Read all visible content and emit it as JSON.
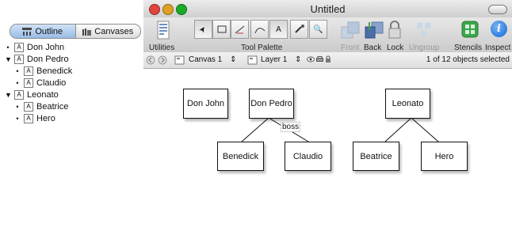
{
  "outline": {
    "tabs": [
      {
        "label": "Outline",
        "icon": "hierarchy-icon",
        "active": true
      },
      {
        "label": "Canvases",
        "icon": "canvases-icon",
        "active": false
      }
    ],
    "tree": [
      {
        "label": "Don John",
        "marker": "•",
        "icon_letter": "A"
      },
      {
        "label": "Don Pedro",
        "marker": "▼",
        "icon_letter": "A"
      },
      {
        "label": "Benedick",
        "marker": "•",
        "icon_letter": "A"
      },
      {
        "label": "Claudio",
        "marker": "•",
        "icon_letter": "A"
      },
      {
        "label": "Leonato",
        "marker": "▼",
        "icon_letter": "A"
      },
      {
        "label": "Beatrice",
        "marker": "•",
        "icon_letter": "A"
      },
      {
        "label": "Hero",
        "marker": "•",
        "icon_letter": "A"
      }
    ]
  },
  "window": {
    "title": "Untitled",
    "traffic_colors": {
      "close": "#e0443e",
      "minimize": "#dea123",
      "zoom": "#1aab29"
    }
  },
  "toolbar": {
    "utilities_label": "Utilities",
    "tool_palette_label": "Tool Palette",
    "front_label": "Front",
    "back_label": "Back",
    "lock_label": "Lock",
    "ungroup_label": "Ungroup",
    "stencils_label": "Stencils",
    "inspect_label": "Inspect",
    "tool_glyphs": {
      "select": "➤",
      "text": "A",
      "zoom": "🔍",
      "inspect": "i"
    },
    "accent": "#2f7de1",
    "stencil_color": "#3aa64a"
  },
  "subbar": {
    "canvas_label": "Canvas 1",
    "layer_label": "Layer 1",
    "stepper": "⇕",
    "selection_status": "1 of 12 objects selected"
  },
  "diagram": {
    "nodes": {
      "don_john": "Don John",
      "don_pedro": "Don Pedro",
      "leonato": "Leonato",
      "benedick": "Benedick",
      "claudio": "Claudio",
      "beatrice": "Beatrice",
      "hero": "Hero"
    },
    "edge_label": "boss"
  }
}
